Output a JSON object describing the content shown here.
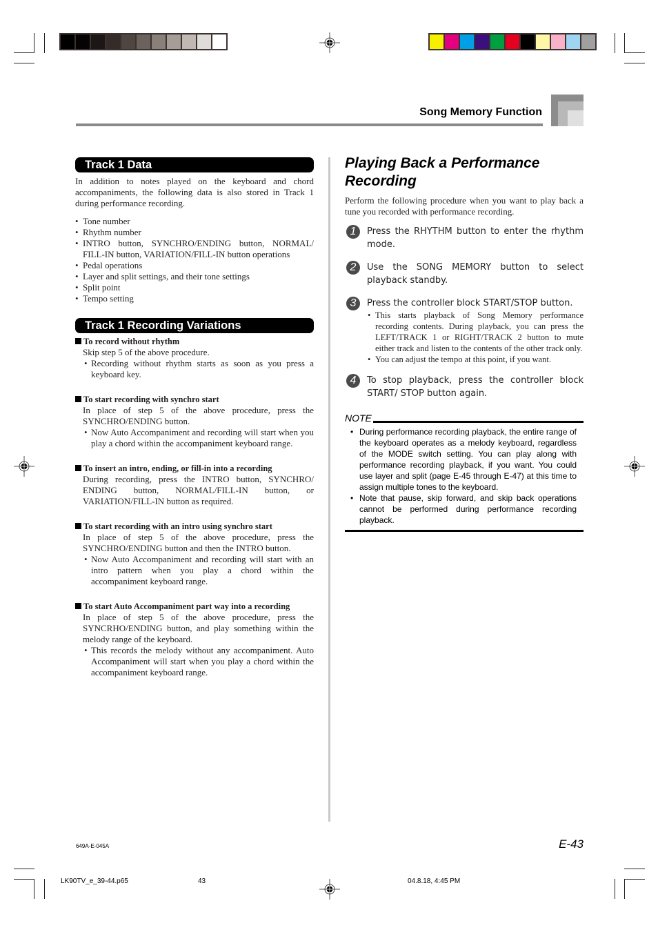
{
  "print_marks": {
    "grayscale_swatches": [
      "#000000",
      "#050303",
      "#1c1716",
      "#352b29",
      "#4f4642",
      "#6c625d",
      "#898079",
      "#a69d98",
      "#c1b8b4",
      "#e0dcd9",
      "#ffffff"
    ],
    "color_swatches": [
      "#f7ef00",
      "#e4007f",
      "#00a0e6",
      "#3b0f7d",
      "#00a040",
      "#e6001f",
      "#000000",
      "#fff7a8",
      "#f7b1c9",
      "#9fd5f3",
      "#a0a0a0"
    ]
  },
  "header": {
    "section_title": "Song Memory Function"
  },
  "left_column": {
    "track1_data": {
      "heading": "Track 1 Data",
      "intro": "In addition to notes played on the keyboard and chord accompaniments, the following data is also stored in Track 1 during performance recording.",
      "items": [
        "Tone number",
        "Rhythm number",
        "INTRO button, SYNCHRO/ENDING button, NORMAL/ FILL-IN button, VARIATION/FILL-IN button operations",
        "Pedal operations",
        "Layer and split settings, and their tone settings",
        "Split point",
        "Tempo setting"
      ]
    },
    "variations": {
      "heading": "Track 1 Recording Variations",
      "subsections": [
        {
          "title": "To record without rhythm",
          "body": "Skip step 5 of the above procedure.",
          "bullets": [
            "Recording without rhythm starts as soon as you press a keyboard key."
          ]
        },
        {
          "title": "To start recording with synchro start",
          "body": "In place of step 5 of the above procedure, press the SYNCHRO/ENDING button.",
          "bullets": [
            "Now Auto Accompaniment and recording will start when you play a chord within the accompaniment keyboard range."
          ]
        },
        {
          "title": "To insert an intro, ending, or fill-in into a recording",
          "body": "During recording, press the INTRO button, SYNCHRO/ ENDING button, NORMAL/FILL-IN button, or VARIATION/FILL-IN button as required.",
          "bullets": []
        },
        {
          "title": "To start recording with an intro using synchro start",
          "body": "In place of step 5 of the above procedure, press the SYNCHRO/ENDING button and then the INTRO button.",
          "bullets": [
            "Now Auto Accompaniment and recording will start with an intro pattern when you play a chord within the accompaniment keyboard range."
          ]
        },
        {
          "title": "To start Auto Accompaniment part way into a recording",
          "body": "In place of step 5 of the above procedure, press the SYNCRHO/ENDING button, and play something within the melody range of the keyboard.",
          "bullets": [
            "This records the melody without any accompaniment. Auto Accompaniment will start when you play a chord within the accompaniment keyboard range."
          ]
        }
      ]
    }
  },
  "right_column": {
    "title": "Playing Back a Performance Recording",
    "intro": "Perform the following procedure when you want to play back a tune you recorded with performance recording.",
    "steps": [
      {
        "number": "1",
        "text": "Press the RHYTHM button to enter the rhythm mode.",
        "bullets": []
      },
      {
        "number": "2",
        "text": "Use the SONG MEMORY button to select playback standby.",
        "bullets": []
      },
      {
        "number": "3",
        "text": "Press the controller block START/STOP button.",
        "bullets": [
          "This starts playback of Song Memory performance recording contents. During playback, you can press the LEFT/TRACK 1 or RIGHT/TRACK 2 button to mute either track and listen to the contents of the other track only.",
          "You can adjust the tempo at this point, if you want."
        ]
      },
      {
        "number": "4",
        "text": "To stop playback, press the controller block START/ STOP button again.",
        "bullets": []
      }
    ],
    "note": {
      "label": "NOTE",
      "items": [
        "During performance recording playback, the entire range of the keyboard operates as a melody keyboard, regardless of the MODE switch setting. You can play along with performance recording playback, if you want. You could use layer and split (page E-45 through E-47) at this time to assign multiple tones to the keyboard.",
        "Note that pause, skip forward, and skip back operations cannot be performed during performance recording playback."
      ]
    }
  },
  "footer": {
    "doc_code": "649A-E-045A",
    "page_number": "E-43",
    "slug_file": "LK90TV_e_39-44.p65",
    "slug_page": "43",
    "slug_date": "04.8.18, 4:45 PM"
  }
}
